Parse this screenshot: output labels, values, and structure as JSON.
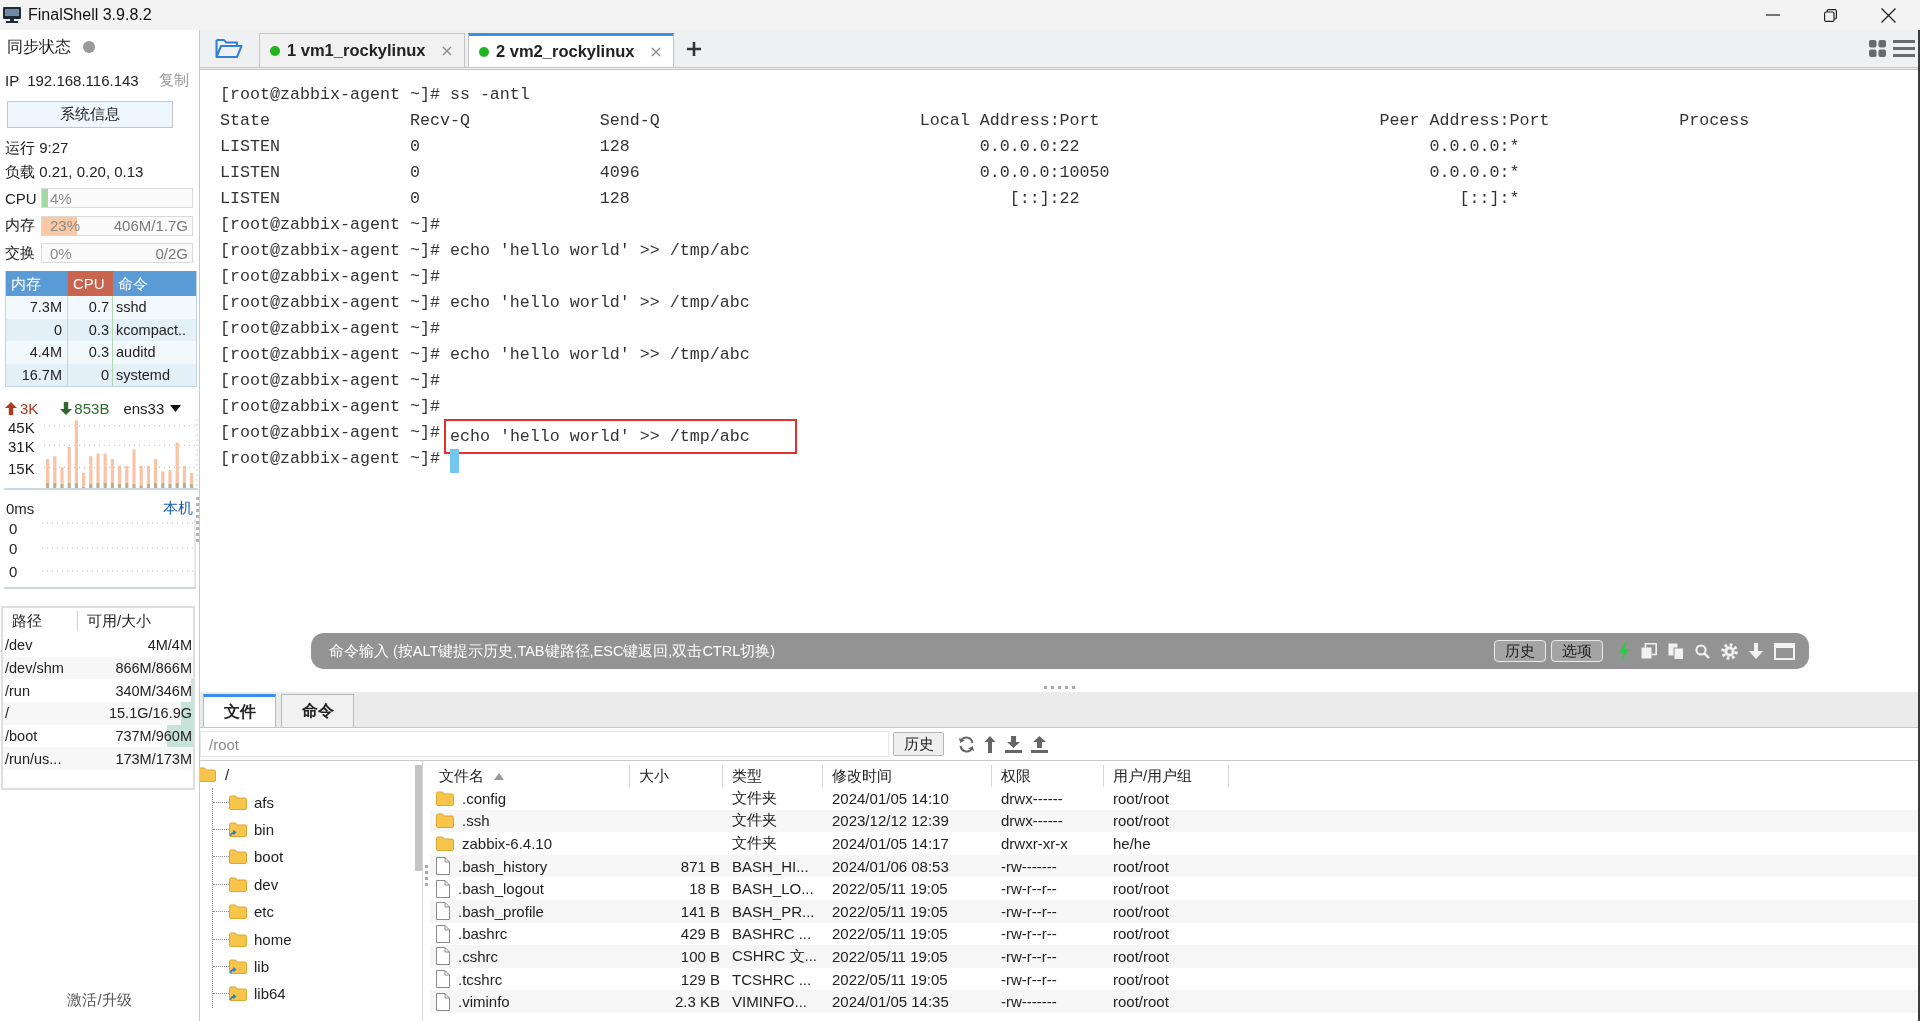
{
  "window": {
    "title": "FinalShell 3.9.8.2"
  },
  "sidebar": {
    "sync": {
      "label": "同步状态",
      "on": false
    },
    "ip": {
      "label": "IP",
      "value": "192.168.116.143",
      "copy": "复制"
    },
    "info_button": "系统信息",
    "uptime": "运行 9:27",
    "load": "负载 0.21, 0.20, 0.13",
    "meters": [
      {
        "label": "CPU",
        "reading": "4%",
        "level": 0.04,
        "color": "#a6d9a2"
      },
      {
        "label": "内存",
        "reading": "23%",
        "detail": "406M/1.7G",
        "level": 0.23,
        "color": "#f8c9a4"
      },
      {
        "label": "交换",
        "reading": "0%",
        "detail": "0/2G",
        "level": 0
      }
    ],
    "processes": {
      "columns": [
        {
          "label": "内存",
          "selected": false
        },
        {
          "label": "CPU",
          "selected": true
        },
        {
          "label": "命令",
          "selected": false
        }
      ],
      "rows": [
        {
          "memory": "7.3M",
          "cpu": "0.7",
          "command": "sshd"
        },
        {
          "memory": "0",
          "cpu": "0.3",
          "command": "kcompact.."
        },
        {
          "memory": "4.4M",
          "cpu": "0.3",
          "command": "auditd"
        },
        {
          "memory": "16.7M",
          "cpu": "0",
          "command": "systemd"
        }
      ]
    },
    "network": {
      "upload": "3K",
      "download": "853B",
      "interface": "ens33",
      "chart_data": {
        "type": "bar",
        "stacked": true,
        "grid": true,
        "ylim": [
          0,
          50
        ],
        "yticks": [
          {
            "value": 15,
            "label": "15K"
          },
          {
            "value": 31,
            "label": "31K"
          },
          {
            "value": 45,
            "label": "45K"
          }
        ],
        "series": [
          {
            "color": "#bcae8e",
            "values": [
              4,
              4,
              3,
              4,
              4,
              1,
              3,
              4,
              4,
              4,
              3,
              4,
              3,
              2,
              3,
              4,
              4,
              3,
              4,
              4,
              3
            ]
          },
          {
            "color": "#f9c4a6",
            "values": [
              17,
              19,
              12,
              26,
              45,
              10,
              20,
              21,
              21,
              17,
              13,
              12,
              25,
              14,
              13,
              17,
              8,
              10,
              29,
              12,
              8
            ]
          }
        ]
      }
    },
    "latency": {
      "reading": "0ms",
      "host": "本机",
      "tick_labels": [
        "0",
        "0",
        "0"
      ]
    },
    "disks": {
      "columns": [
        "路径",
        "可用/大小"
      ],
      "rows": [
        {
          "path": "/dev",
          "space": "4M/4M",
          "level": 0
        },
        {
          "path": "/dev/shm",
          "space": "866M/866M",
          "level": 0
        },
        {
          "path": "/run",
          "space": "340M/346M",
          "level": 0.02
        },
        {
          "path": "/",
          "space": "15.1G/16.9G",
          "level": 0.11
        },
        {
          "path": "/boot",
          "space": "737M/960M",
          "level": 0.23
        },
        {
          "path": "/run/us...",
          "space": "173M/173M",
          "level": 0
        }
      ]
    },
    "footer": "激活/升级"
  },
  "tabs": [
    {
      "label": "1 vm1_rockylinux",
      "selected": false,
      "connected": true
    },
    {
      "label": "2 vm2_rockylinux",
      "selected": true,
      "connected": true
    }
  ],
  "terminal": {
    "lines": [
      {
        "kind": "prompt",
        "prompt": "[root@zabbix-agent ~]#",
        "command": "ss -antl",
        "highlighted": false
      },
      {
        "kind": "output",
        "cells": [
          "State",
          "Recv-Q",
          "Send-Q",
          "Local Address:Port",
          "Peer Address:Port",
          "Process"
        ],
        "highlighted": false
      },
      {
        "kind": "output",
        "cells": [
          "LISTEN",
          "0",
          "128",
          "0.0.0.0:22",
          "0.0.0.0:*"
        ],
        "highlighted": false
      },
      {
        "kind": "output",
        "cells": [
          "LISTEN",
          "0",
          "4096",
          "0.0.0.0:10050",
          "0.0.0.0:*"
        ],
        "highlighted": false
      },
      {
        "kind": "output",
        "cells": [
          "LISTEN",
          "0",
          "128",
          "[::]:22",
          "[::]:*"
        ],
        "highlighted": false
      },
      {
        "kind": "prompt",
        "prompt": "[root@zabbix-agent ~]#",
        "highlighted": false
      },
      {
        "kind": "prompt",
        "prompt": "[root@zabbix-agent ~]#",
        "command": "echo 'hello world' >> /tmp/abc",
        "highlighted": false
      },
      {
        "kind": "prompt",
        "prompt": "[root@zabbix-agent ~]#",
        "highlighted": false
      },
      {
        "kind": "prompt",
        "prompt": "[root@zabbix-agent ~]#",
        "command": "echo 'hello world' >> /tmp/abc",
        "highlighted": false
      },
      {
        "kind": "prompt",
        "prompt": "[root@zabbix-agent ~]#",
        "highlighted": false
      },
      {
        "kind": "prompt",
        "prompt": "[root@zabbix-agent ~]#",
        "command": "echo 'hello world' >> /tmp/abc",
        "highlighted": false
      },
      {
        "kind": "prompt",
        "prompt": "[root@zabbix-agent ~]#",
        "highlighted": false
      },
      {
        "kind": "prompt",
        "prompt": "[root@zabbix-agent ~]#",
        "highlighted": false
      },
      {
        "kind": "prompt",
        "prompt": "[root@zabbix-agent ~]#",
        "command": "echo 'hello world' >> /tmp/abc",
        "highlighted": true
      },
      {
        "kind": "prompt",
        "prompt": "[root@zabbix-agent ~]#",
        "highlighted": false
      }
    ],
    "cursor": true
  },
  "command_bar": {
    "placeholder": "命令输入 (按ALT键提示历史,TAB键路径,ESC键返回,双击CTRL切换)",
    "buttons": [
      "历史",
      "选项"
    ]
  },
  "file_panel": {
    "tabs": [
      {
        "label": "文件",
        "selected": true
      },
      {
        "label": "命令",
        "selected": false
      }
    ],
    "path": "/root",
    "history_button": "历史",
    "tree": {
      "label": "/",
      "symlink": false,
      "children": [
        {
          "label": "afs",
          "symlink": false
        },
        {
          "label": "bin",
          "symlink": true
        },
        {
          "label": "boot",
          "symlink": false
        },
        {
          "label": "dev",
          "symlink": false
        },
        {
          "label": "etc",
          "symlink": false
        },
        {
          "label": "home",
          "symlink": false
        },
        {
          "label": "lib",
          "symlink": true
        },
        {
          "label": "lib64",
          "symlink": true
        }
      ]
    },
    "columns": [
      {
        "label": "文件名",
        "sorted": true
      },
      {
        "label": "大小",
        "sorted": false
      },
      {
        "label": "类型",
        "sorted": false
      },
      {
        "label": "修改时间",
        "sorted": false
      },
      {
        "label": "权限",
        "sorted": false
      },
      {
        "label": "用户/用户组",
        "sorted": false
      }
    ],
    "files": [
      {
        "kind": "folder",
        "name": ".config",
        "type": "文件夹",
        "modified": "2024/01/05 14:10",
        "permissions": "drwx------",
        "owner": "root/root"
      },
      {
        "kind": "folder",
        "name": ".ssh",
        "type": "文件夹",
        "modified": "2023/12/12 12:39",
        "permissions": "drwx------",
        "owner": "root/root"
      },
      {
        "kind": "folder",
        "name": "zabbix-6.4.10",
        "type": "文件夹",
        "modified": "2024/01/05 14:17",
        "permissions": "drwxr-xr-x",
        "owner": "he/he"
      },
      {
        "kind": "file",
        "name": ".bash_history",
        "size": "871 B",
        "type": "BASH_HI...",
        "modified": "2024/01/06 08:53",
        "permissions": "-rw-------",
        "owner": "root/root"
      },
      {
        "kind": "file",
        "name": ".bash_logout",
        "size": "18 B",
        "type": "BASH_LO...",
        "modified": "2022/05/11 19:05",
        "permissions": "-rw-r--r--",
        "owner": "root/root"
      },
      {
        "kind": "file",
        "name": ".bash_profile",
        "size": "141 B",
        "type": "BASH_PR...",
        "modified": "2022/05/11 19:05",
        "permissions": "-rw-r--r--",
        "owner": "root/root"
      },
      {
        "kind": "file",
        "name": ".bashrc",
        "size": "429 B",
        "type": "BASHRC ...",
        "modified": "2022/05/11 19:05",
        "permissions": "-rw-r--r--",
        "owner": "root/root"
      },
      {
        "kind": "file",
        "name": ".cshrc",
        "size": "100 B",
        "type": "CSHRC 文...",
        "modified": "2022/05/11 19:05",
        "permissions": "-rw-r--r--",
        "owner": "root/root"
      },
      {
        "kind": "file",
        "name": ".tcshrc",
        "size": "129 B",
        "type": "TCSHRC ...",
        "modified": "2022/05/11 19:05",
        "permissions": "-rw-r--r--",
        "owner": "root/root"
      },
      {
        "kind": "file",
        "name": ".viminfo",
        "size": "2.3 KB",
        "type": "VIMINFO...",
        "modified": "2024/01/05 14:35",
        "permissions": "-rw-------",
        "owner": "root/root"
      }
    ]
  }
}
